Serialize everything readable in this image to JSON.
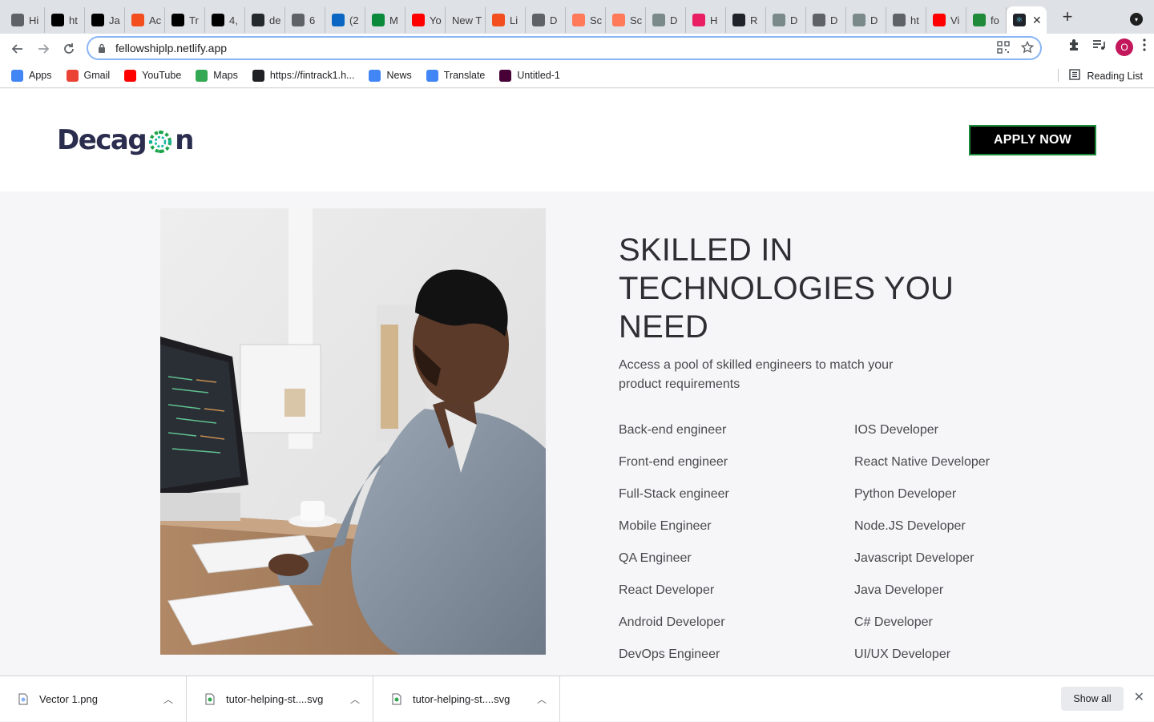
{
  "browser": {
    "tabs": [
      {
        "label": "Hi",
        "icon": "circle-icon",
        "color": "#5f6368"
      },
      {
        "label": "ht",
        "icon": "a-logo-icon",
        "color": "#000000"
      },
      {
        "label": "Ja",
        "icon": "a-logo-icon",
        "color": "#000000"
      },
      {
        "label": "Ac",
        "icon": "figma-icon",
        "color": "#f24e1e"
      },
      {
        "label": "Tr",
        "icon": "notion-icon",
        "color": "#000000"
      },
      {
        "label": "4,",
        "icon": "is-icon",
        "color": "#000000"
      },
      {
        "label": "de",
        "icon": "github-icon",
        "color": "#24292e"
      },
      {
        "label": "6",
        "icon": "globe-icon",
        "color": "#5f6368"
      },
      {
        "label": "(2",
        "icon": "linkedin-icon",
        "color": "#0a66c2"
      },
      {
        "label": "M",
        "icon": "grid-icon",
        "color": "#0a8a3a"
      },
      {
        "label": "Yo",
        "icon": "youtube-icon",
        "color": "#ff0000"
      },
      {
        "label": "New T",
        "icon": "",
        "color": ""
      },
      {
        "label": "Li",
        "icon": "figma-icon",
        "color": "#f24e1e"
      },
      {
        "label": "D",
        "icon": "globe-icon",
        "color": "#5f6368"
      },
      {
        "label": "Sc",
        "icon": "hubspot-icon",
        "color": "#ff7a59"
      },
      {
        "label": "Sc",
        "icon": "hubspot-icon",
        "color": "#ff7a59"
      },
      {
        "label": "D",
        "icon": "dots-icon",
        "color": "#7a8a8a"
      },
      {
        "label": "H",
        "icon": "record-icon",
        "color": "#e91e63"
      },
      {
        "label": "R",
        "icon": "react-icon",
        "color": "#20232a"
      },
      {
        "label": "D",
        "icon": "dots-icon",
        "color": "#7a8a8a"
      },
      {
        "label": "D",
        "icon": "globe-icon",
        "color": "#5f6368"
      },
      {
        "label": "D",
        "icon": "dots-icon",
        "color": "#7a8a8a"
      },
      {
        "label": "ht",
        "icon": "globe-icon",
        "color": "#5f6368"
      },
      {
        "label": "Vi",
        "icon": "youtube-icon",
        "color": "#ff0000"
      },
      {
        "label": "fo",
        "icon": "y-logo-icon",
        "color": "#1e8a3a"
      }
    ],
    "active_tab_close": "✕",
    "new_tab": "+",
    "url": "fellowshiplp.netlify.app",
    "profile_initial": "O",
    "bookmarks": [
      {
        "label": "Apps",
        "icon": "apps-grid-icon",
        "color": "#4285f4"
      },
      {
        "label": "Gmail",
        "icon": "gmail-icon",
        "color": "#ea4335"
      },
      {
        "label": "YouTube",
        "icon": "youtube-icon",
        "color": "#ff0000"
      },
      {
        "label": "Maps",
        "icon": "maps-icon",
        "color": "#34a853"
      },
      {
        "label": "https://fintrack1.h...",
        "icon": "globe-icon",
        "color": "#202124"
      },
      {
        "label": "News",
        "icon": "news-icon",
        "color": "#4285f4"
      },
      {
        "label": "Translate",
        "icon": "translate-icon",
        "color": "#4285f4"
      },
      {
        "label": "Untitled-1",
        "icon": "xd-icon",
        "color": "#470137"
      }
    ],
    "reading_list": "Reading List"
  },
  "site": {
    "logo_left": "Decag",
    "logo_right": "n",
    "logo_colors": {
      "text": "#2b2d4f",
      "green": "#1ea44a",
      "teal": "#15b4a0"
    },
    "apply_label": "APPLY NOW",
    "heading": "SKILLED IN TECHNOLOGIES YOU NEED",
    "subtext": "Access a pool of skilled engineers to match your product requirements",
    "roles_left": [
      "Back-end engineer",
      "Front-end engineer",
      "Full-Stack engineer",
      "Mobile Engineer",
      "QA Engineer",
      "React Developer",
      "Android Developer",
      "DevOps Engineer"
    ],
    "roles_right": [
      "IOS Developer",
      "React Native Developer",
      "Python Developer",
      "Node.JS Developer",
      "Javascript Developer",
      "Java Developer",
      "C# Developer",
      "UI/UX Developer"
    ]
  },
  "downloads": {
    "items": [
      {
        "name": "Vector 1.png"
      },
      {
        "name": "tutor-helping-st....svg"
      },
      {
        "name": "tutor-helping-st....svg"
      }
    ],
    "show_all": "Show all"
  }
}
